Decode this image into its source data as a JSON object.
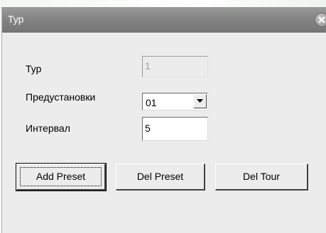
{
  "dialog": {
    "title": "Тур",
    "close_icon": "close-icon"
  },
  "form": {
    "tour_label": "Тур",
    "tour_value": "1",
    "presets_label": "Предустановки",
    "presets_selected": "01",
    "interval_label": "Интервал",
    "interval_value": "5"
  },
  "buttons": {
    "add_preset": "Add Preset",
    "del_preset": "Del Preset",
    "del_tour": "Del Tour"
  }
}
